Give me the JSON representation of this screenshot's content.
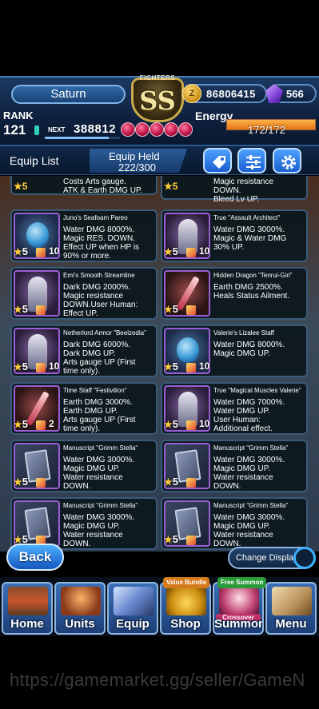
{
  "header": {
    "player_name": "Saturn",
    "rank_label": "RANK",
    "rank_value": "121",
    "next_label": "NEXT",
    "next_value": "388812",
    "badge_fighters": "FIGHTERS",
    "badge_grade": "SS",
    "coins": "86806415",
    "gems": "566",
    "energy_label": "Energy",
    "energy_value": "172/172",
    "energy_fraction": 1.0,
    "rank_exp_fraction": 0.85
  },
  "equip_bar": {
    "title": "Equip List",
    "held_label": "Equip Held",
    "held_value": "222/300"
  },
  "cards_top": [
    {
      "desc": "Costs Arts gauge.\nATK & Earth DMG UP.",
      "rarity": "5",
      "level": "10"
    },
    {
      "desc": "Magic resistance\nDOWN.\nBleed Lv UP.",
      "rarity": "5",
      "level": ""
    }
  ],
  "cards": [
    {
      "name": "Juno's Seafoam Pareo",
      "desc": "Water DMG 8000%.\nMagic RES. DOWN.\nEffect UP when HP is\n90% or more.",
      "rarity": "5",
      "level": "10",
      "thumb": "gem"
    },
    {
      "name": "True \"Assault Architect\"",
      "desc": "Water DMG 3000%.\nMagic & Water DMG\n30% UP.",
      "rarity": "5",
      "level": "10",
      "thumb": "figure"
    },
    {
      "name": "Emi's Smooth Streamline",
      "desc": "Dark DMG 2000%.\nMagic resistance\nDOWN.User Human:\nEffect UP.",
      "rarity": "5",
      "level": "",
      "thumb": "figure"
    },
    {
      "name": "Hidden Dragon \"Tenrui-Giri\"",
      "desc": "Earth DMG 2500%.\nHeals Status Ailment.",
      "rarity": "5",
      "level": "",
      "thumb": "blade"
    },
    {
      "name": "Netherlord Armor \"Beelzedia\"",
      "desc": "Dark DMG 6000%.\nDark DMG UP.\nArts gauge UP (First\ntime only).",
      "rarity": "5",
      "level": "10",
      "thumb": "figure"
    },
    {
      "name": "Valerie's Lizalee Staff",
      "desc": "Water DMG 8000%.\nMagic DMG UP.",
      "rarity": "5",
      "level": "10",
      "thumb": "gem"
    },
    {
      "name": "Time Staff \"Festivilion\"",
      "desc": "Earth DMG 3000%.\nEarth DMG UP.\nArts gauge UP (First\ntime only).",
      "rarity": "5",
      "level": "2",
      "thumb": "blade"
    },
    {
      "name": "True \"Magical Muscles Valerie\"",
      "desc": "Water DMG 7000%.\nWater DMG UP.\nUser Human:\nAdditional effect.",
      "rarity": "5",
      "level": "10",
      "thumb": "figure"
    },
    {
      "name": "Manuscript \"Grimm Stella\"",
      "desc": "Water DMG 3000%.\nMagic DMG UP.\nWater resistance\nDOWN.",
      "rarity": "5",
      "level": "",
      "thumb": "book"
    },
    {
      "name": "Manuscript \"Grimm Stella\"",
      "desc": "Water DMG 3000%.\nMagic DMG UP.\nWater resistance\nDOWN.",
      "rarity": "5",
      "level": "",
      "thumb": "book"
    },
    {
      "name": "Manuscript \"Grimm Stella\"",
      "desc": "Water DMG 3000%.\nMagic DMG UP.\nWater resistance\nDOWN.",
      "rarity": "5",
      "level": "",
      "thumb": "book"
    },
    {
      "name": "Manuscript \"Grimm Stella\"",
      "desc": "Water DMG 3000%.\nMagic DMG UP.\nWater resistance\nDOWN.",
      "rarity": "5",
      "level": "",
      "thumb": "book"
    }
  ],
  "bottom": {
    "back_label": "Back",
    "change_display_label": "Change Display"
  },
  "nav": [
    {
      "label": "Home",
      "tag": ""
    },
    {
      "label": "Units",
      "tag": ""
    },
    {
      "label": "Equip",
      "tag": ""
    },
    {
      "label": "Shop",
      "tag": "Value Bundle"
    },
    {
      "label": "Summon",
      "tag": "Free Summon",
      "sub": "Crossover"
    },
    {
      "label": "Menu",
      "tag": ""
    }
  ],
  "watermark": "https://gamemarket.gg/seller/GameN",
  "colors": {
    "accent_blue": "#1b5fd0",
    "energy_orange": "#e37415",
    "card_border": "#3b5a78",
    "rarity_star": "#ffcf3a"
  }
}
